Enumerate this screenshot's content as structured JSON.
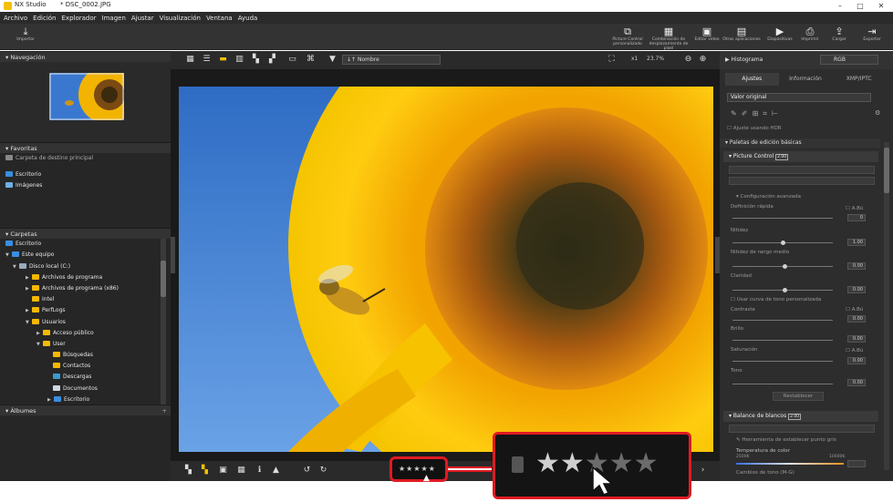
{
  "window": {
    "app_name": "NX Studio",
    "file_title": "* DSC_0002.JPG",
    "minimize": "–",
    "maximize": "□",
    "close": "✕"
  },
  "menu": [
    "Archivo",
    "Edición",
    "Explorador",
    "Imagen",
    "Ajustar",
    "Visualización",
    "Ventana",
    "Ayuda"
  ],
  "toolbar": {
    "import_label": "Importar",
    "right_buttons": [
      {
        "icon": "picture-control-icon",
        "label1": "Picture Control",
        "label2": "personalizado"
      },
      {
        "icon": "pixel-shift-icon",
        "label1": "Combinación de",
        "label2": "desplazamiento de píxel"
      },
      {
        "icon": "movie-editor-icon",
        "label1": "Editar vídeo",
        "label2": ""
      },
      {
        "icon": "other-apps-icon",
        "label1": "Otras aplicaciones",
        "label2": ""
      },
      {
        "icon": "slideshow-icon",
        "label1": "Diapositivas",
        "label2": ""
      },
      {
        "icon": "print-icon",
        "label1": "Imprimir",
        "label2": ""
      },
      {
        "icon": "upload-icon",
        "label1": "Cargar",
        "label2": ""
      },
      {
        "icon": "export-icon",
        "label1": "Exportar",
        "label2": ""
      }
    ]
  },
  "left": {
    "navigation_title": "Navegación",
    "favorites_title": "Favoritas",
    "favorites_dest": "Carpeta de destino principal",
    "favorites_items": [
      "Escritorio",
      "Imágenes"
    ],
    "folders_title": "Carpetas",
    "tree": [
      {
        "label": "Escritorio",
        "level": 0
      },
      {
        "label": "Este equipo",
        "level": 1
      },
      {
        "label": "Disco local (C:)",
        "level": 2
      },
      {
        "label": "Archivos de programa",
        "level": 3
      },
      {
        "label": "Archivos de programa (x86)",
        "level": 3
      },
      {
        "label": "Intel",
        "level": 3
      },
      {
        "label": "PerfLogs",
        "level": 3
      },
      {
        "label": "Usuarios",
        "level": 3
      },
      {
        "label": "Acceso público",
        "level": 4
      },
      {
        "label": "User",
        "level": 4
      },
      {
        "label": "Búsquedas",
        "level": 5
      },
      {
        "label": "Contactos",
        "level": 5
      },
      {
        "label": "Descargas",
        "level": 5
      },
      {
        "label": "Documentos",
        "level": 5
      },
      {
        "label": "Escritorio",
        "level": 5
      }
    ],
    "albums_title": "Álbumes"
  },
  "viewer": {
    "sort_label": "Nombre",
    "zoom_x1": "x1",
    "zoom_percent": "23.7%",
    "rating_mini": "★★★★★",
    "rating_value": 2
  },
  "right": {
    "histogram_title": "Histograma",
    "histogram_mode": "RGB",
    "tabs": [
      "Ajustes",
      "Información",
      "XMP/IPTC"
    ],
    "preset": "Valor original",
    "hdr_label": "Ajuste usando HDR",
    "basic_palettes": "Paletas de edición básicas",
    "picture_control": "Picture Control",
    "picture_control_badge": "2.00",
    "advanced": "Configuración avanzada",
    "quick_sharp": "Definición rápida",
    "auto_label": "A.Bú",
    "sharpening": "Nitidez",
    "mid_sharpening": "Nitidez de rango medio",
    "clarity": "Claridad",
    "custom_curve": "Usar curva de tono personalizada",
    "contrast": "Contraste",
    "brightness": "Brillo",
    "saturation": "Saturación",
    "hue": "Tono",
    "reset": "Restablecer",
    "white_balance": "Balance de blancos",
    "white_balance_badge": "2.00",
    "gray_point_tool": "Herramienta de establecer punto gris",
    "color_temp": "Temperatura de color",
    "temp_min": "2500K",
    "temp_max": "10000K",
    "tint": "Cambios de tono (M-G)",
    "val_zero": "0.00",
    "val_zero_one": "1.00",
    "val_zero_short": "0"
  },
  "callout": {
    "stars_total": 5,
    "stars_filled": 2
  }
}
